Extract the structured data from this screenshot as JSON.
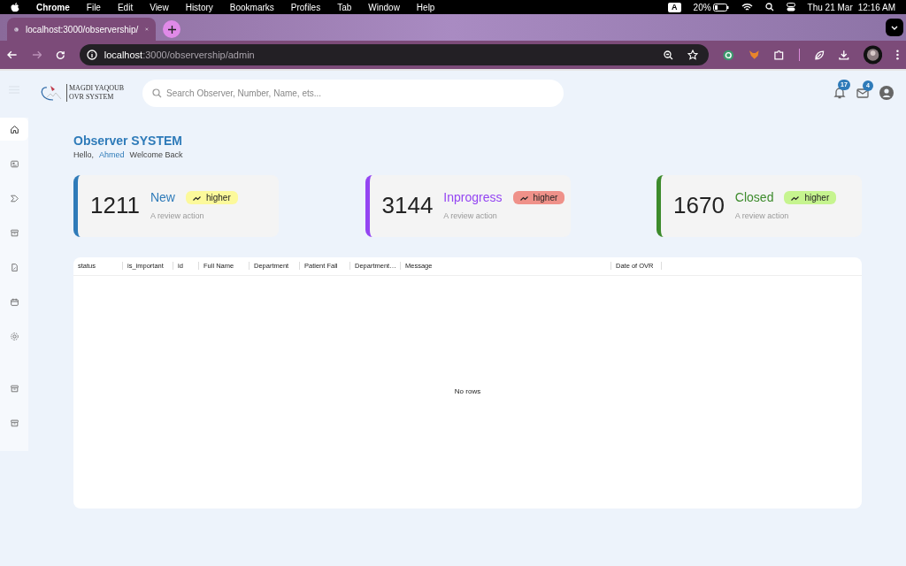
{
  "menu_bar": {
    "app": "Chrome",
    "items": [
      "File",
      "Edit",
      "View",
      "History",
      "Bookmarks",
      "Profiles",
      "Tab",
      "Window",
      "Help"
    ],
    "input_badge": "A",
    "battery": "20%",
    "date": "Thu 21 Mar",
    "time": "12:16 AM"
  },
  "browser": {
    "tab_title": "localhost:3000/observership/",
    "url_host": "localhost",
    "url_path": ":3000/observership/admin"
  },
  "header": {
    "logo_line_1": "MAGDI YAQOUB",
    "logo_line_2": "OVR SYSTEM",
    "search": {
      "placeholder": "Search Observer, Number, Name, ets..."
    },
    "notifications": "17",
    "messages": "4"
  },
  "sidebar": {
    "items": [
      {
        "kind": "home",
        "selected": true
      },
      {
        "kind": "news",
        "selected": false
      },
      {
        "kind": "tag",
        "selected": false
      },
      {
        "kind": "archive",
        "selected": false
      },
      {
        "kind": "doc",
        "selected": false
      },
      {
        "kind": "calendar",
        "selected": false
      },
      {
        "kind": "gear",
        "selected": false
      },
      {
        "kind": "archive",
        "selected": false
      },
      {
        "kind": "archive",
        "selected": false
      }
    ]
  },
  "page": {
    "title": "Observer SYSTEM",
    "greeting": "Hello,",
    "user": "Ahmed",
    "welcome": "Welcome Back"
  },
  "cards": [
    {
      "count": "1211",
      "label": "New",
      "color": "#2f7bb9",
      "badge": "higher",
      "caption": "A review action"
    },
    {
      "count": "3144",
      "label": "Inprogress",
      "color": "#9445f2",
      "badge": "higher",
      "caption": "A review action"
    },
    {
      "count": "1670",
      "label": "Closed",
      "color": "#3d8b2c",
      "badge": "higher",
      "caption": "A review action"
    }
  ],
  "table": {
    "columns": [
      "status",
      "is_important",
      "id",
      "Full Name",
      "Department",
      "Patient Fall",
      "Department…",
      "Message",
      "Date of OVR"
    ],
    "empty": "No rows"
  }
}
